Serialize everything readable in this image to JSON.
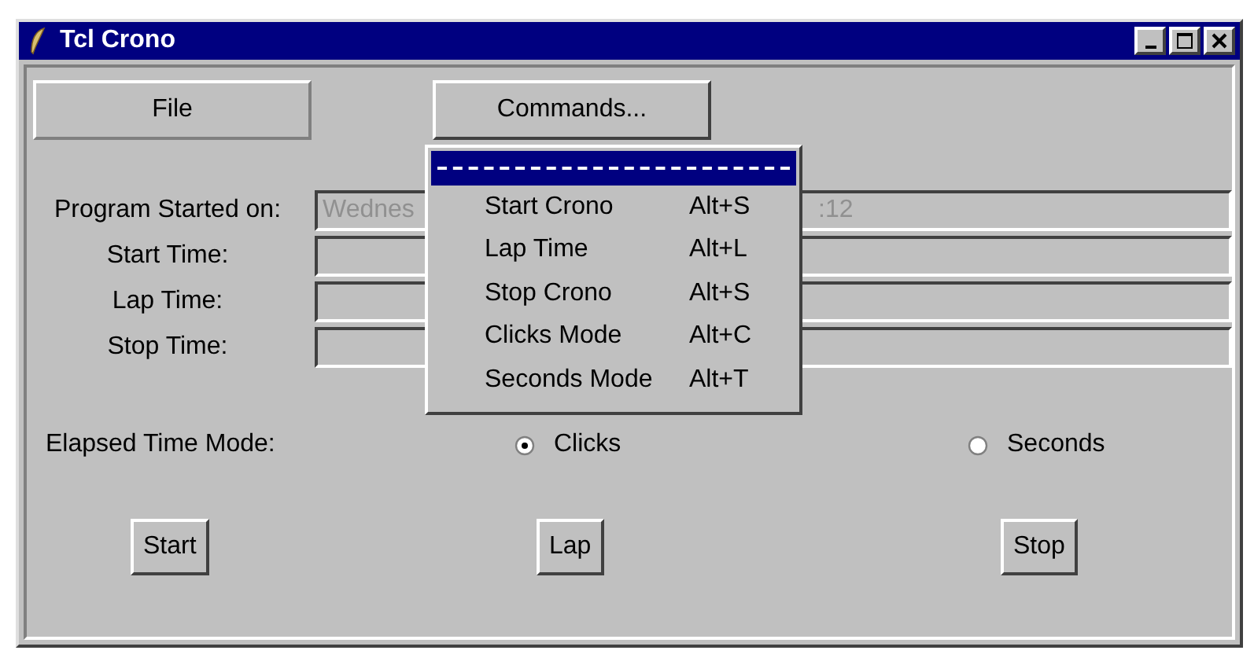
{
  "window": {
    "title": "Tcl Crono"
  },
  "menubar": [
    {
      "label": "File",
      "selected": false
    },
    {
      "label": "Commands...",
      "selected": true
    }
  ],
  "menu": {
    "tearoff_selected": true,
    "items": [
      {
        "label": "Start Crono",
        "shortcut": "Alt+S"
      },
      {
        "label": "Lap Time",
        "shortcut": "Alt+L"
      },
      {
        "label": "Stop Crono",
        "shortcut": "Alt+S"
      },
      {
        "label": "Clicks Mode",
        "shortcut": "Alt+C"
      },
      {
        "label": "Seconds Mode",
        "shortcut": "Alt+T"
      }
    ]
  },
  "fields": [
    {
      "label": "Program Started on:",
      "value_parts": [
        "Wednes",
        ":12"
      ]
    },
    {
      "label": "Start Time:"
    },
    {
      "label": "Lap Time:"
    },
    {
      "label": "Stop Time:"
    }
  ],
  "mode": {
    "label": "Elapsed Time Mode:",
    "options": [
      {
        "label": "Clicks",
        "selected": true
      },
      {
        "label": "Seconds",
        "selected": false
      }
    ]
  },
  "buttons": [
    "Start",
    "Lap",
    "Stop"
  ]
}
